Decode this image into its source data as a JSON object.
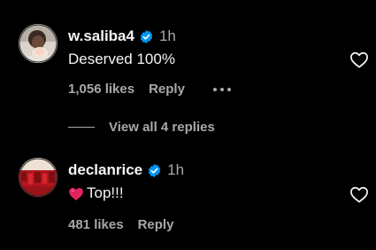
{
  "comments": [
    {
      "username": "w.saliba4",
      "verified": true,
      "time": "1h",
      "text": "Deserved 100%",
      "likes": "1,056 likes",
      "reply_label": "Reply",
      "has_more_menu": true,
      "avatar_icon": "profile-photo",
      "like_icon": "heart-outline-icon"
    },
    {
      "username": "declanrice",
      "verified": true,
      "time": "1h",
      "text_emoji": "heart-emoji",
      "text": "Top!!!",
      "likes": "481 likes",
      "reply_label": "Reply",
      "avatar_icon": "profile-photo",
      "like_icon": "heart-outline-icon"
    }
  ],
  "view_replies": {
    "label": "View all 4 replies"
  },
  "colors": {
    "background": "#000000",
    "primary_text": "#f5f5f5",
    "secondary_text": "#a8a8a8",
    "verified_blue": "#0095f6",
    "emoji_heart": "#e0245e"
  }
}
